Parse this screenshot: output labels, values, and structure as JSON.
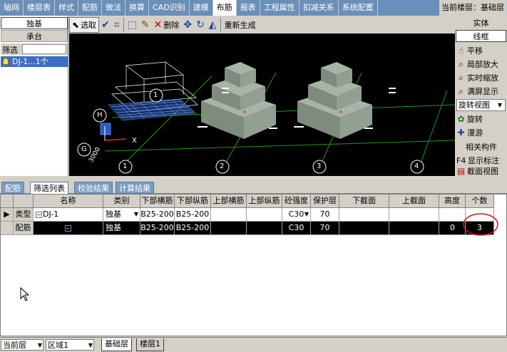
{
  "menu": {
    "items": [
      "轴网",
      "楼层表",
      "样式",
      "配筋",
      "做法",
      "换算",
      "CAD识别",
      "建模",
      "布筋",
      "报表",
      "工程属性",
      "扣减关系",
      "系统配置"
    ],
    "active_index": 8,
    "current_floor": "当前楼层：基础层"
  },
  "left_panel": {
    "btn1": "独基",
    "btn2": "承台",
    "filter_label": "筛选",
    "tree_item": "DJ-1...1个"
  },
  "toolbar": {
    "select": "选取",
    "delete": "删除",
    "regenerate": "重新生成"
  },
  "viewport": {
    "axis_labels": [
      "1",
      "2",
      "3",
      "4"
    ],
    "row_labels": [
      "H",
      "G"
    ],
    "dim_text": "3000",
    "x_label": "X",
    "colors": {
      "background": "#000000",
      "grid_line": "#1e9a1e",
      "solid": "#8a9a8a",
      "mesh": "#3c6fd6"
    }
  },
  "right_panel": {
    "solid": "实体",
    "wireframe": "线框",
    "items": [
      {
        "icon": "pan-icon",
        "label": "平移"
      },
      {
        "icon": "zoom-local-icon",
        "label": "局部放大"
      },
      {
        "icon": "zoom-realtime-icon",
        "label": "实时缩放"
      },
      {
        "icon": "zoom-fit-icon",
        "label": "满屏显示"
      }
    ],
    "view_select": "旋转视图",
    "items2": [
      {
        "icon": "rotate-icon",
        "label": "旋转"
      },
      {
        "icon": "walk-icon",
        "label": "漫游"
      }
    ],
    "related": "相关构件",
    "f4_key": "F4",
    "show_label": "显示标注",
    "section_view": "截面视图"
  },
  "bottom_tabs": [
    "配筋",
    "筛选列表",
    "校验结果",
    "计算结果"
  ],
  "bottom_tabs_active": 1,
  "grid": {
    "headers": [
      "名称",
      "类别",
      "下部横筋",
      "下部纵筋",
      "上部横筋",
      "上部纵筋",
      "砼强度",
      "保护层",
      "下截面",
      "上截面",
      "高度",
      "个数"
    ],
    "rows": [
      {
        "rh": "类型",
        "name": "DJ-1",
        "category": "独基",
        "lower_h": "B25-200",
        "lower_v": "B25-200",
        "upper_h": "",
        "upper_v": "",
        "concrete": "C30",
        "cover": "70",
        "lower_sec": "",
        "upper_sec": "",
        "height": "",
        "count": ""
      },
      {
        "rh": "配筋",
        "name": "",
        "category": "独基",
        "lower_h": "B25-200",
        "lower_v": "B25-200",
        "upper_h": "",
        "upper_v": "",
        "concrete": "C30",
        "cover": "70",
        "lower_sec": "",
        "upper_sec": "",
        "height": "0",
        "count": "3"
      }
    ]
  },
  "status": {
    "floor_combo": "当前层",
    "region_combo": "区域1",
    "tabs": [
      "基础层",
      "楼层1"
    ]
  }
}
